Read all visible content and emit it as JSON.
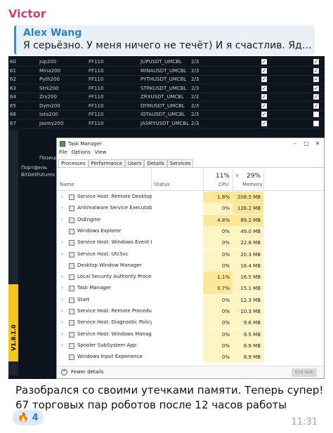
{
  "message": {
    "sender": "Victor",
    "reply": {
      "author": "Alex Wang",
      "text": "Я серьёзно. У меня ничего не течёт) И я счастлив. Ядро на эт..."
    },
    "caption": "Разобрался со своими утечками памяти. Теперь супер! 67 торговых пар роботов после 12 часов работы",
    "reaction": {
      "emoji": "🔥",
      "count": "4"
    },
    "time": "11:31"
  },
  "bot_table": {
    "rows": [
      {
        "id": "60",
        "name": "Jup200",
        "type": "FF110",
        "pair": "JUPUSDT_UMCBL",
        "ratio": "2/3"
      },
      {
        "id": "61",
        "name": "Mina200",
        "type": "FF110",
        "pair": "MINAUSDT_UMCBL",
        "ratio": "2/3"
      },
      {
        "id": "62",
        "name": "Pyth200",
        "type": "FF110",
        "pair": "PYTHUSDT_UMCBL",
        "ratio": "2/3"
      },
      {
        "id": "63",
        "name": "Strk200",
        "type": "FF110",
        "pair": "STRKUSDT_UMCBL",
        "ratio": "2/3"
      },
      {
        "id": "64",
        "name": "Zrx200",
        "type": "FF110",
        "pair": "ZRXUSDT_UMCBL",
        "ratio": "2/2"
      },
      {
        "id": "65",
        "name": "Dym200",
        "type": "FF110",
        "pair": "DYMUSDT_UMCBL",
        "ratio": "2/3"
      },
      {
        "id": "66",
        "name": "Iota200",
        "type": "FF110",
        "pair": "IOTAUSDT_UMCBL",
        "ratio": "2/3"
      },
      {
        "id": "67",
        "name": "Jasmy200",
        "type": "FF110",
        "pair": "JASMYUSDT_UMCBL",
        "ratio": "2/3"
      }
    ],
    "position_label": "Позици",
    "portfolio_label": "Портфель",
    "exchange": "BitGetFutures",
    "version": "V1.8.1.0"
  },
  "task_manager": {
    "title": "Task Manager",
    "menu": [
      "File",
      "Options",
      "View"
    ],
    "tabs": [
      "Processes",
      "Performance",
      "Users",
      "Details",
      "Services"
    ],
    "columns": {
      "name": "Name",
      "status": "Status",
      "cpu_pct": "11%",
      "cpu": "CPU",
      "mem_pct": "29%",
      "memory": "Memory"
    },
    "processes": [
      {
        "expand": "›",
        "name": "Service Host: Remote Desktop S...",
        "cpu": "1.8%",
        "mem": "208.5 MB"
      },
      {
        "expand": "›",
        "name": "Antimalware Service Executable",
        "cpu": "0%",
        "mem": "126.2 MB"
      },
      {
        "expand": "›",
        "name": "OsEngine",
        "cpu": "4.8%",
        "mem": "89.2 MB"
      },
      {
        "expand": "",
        "name": "Windows Explorer",
        "cpu": "0%",
        "mem": "49.0 MB"
      },
      {
        "expand": "›",
        "name": "Service Host: Windows Event Log",
        "cpu": "0%",
        "mem": "22.8 MB"
      },
      {
        "expand": "›",
        "name": "Service Host: UtcSvc",
        "cpu": "0%",
        "mem": "20.3 MB"
      },
      {
        "expand": "",
        "name": "Desktop Window Manager",
        "cpu": "0%",
        "mem": "18.4 MB"
      },
      {
        "expand": "›",
        "name": "Local Security Authority Process...",
        "cpu": "1.1%",
        "mem": "16.5 MB"
      },
      {
        "expand": "›",
        "name": "Task Manager",
        "cpu": "0.7%",
        "mem": "15.1 MB"
      },
      {
        "expand": "›",
        "name": "Start",
        "cpu": "0%",
        "mem": "12.3 MB"
      },
      {
        "expand": "›",
        "name": "Service Host: Remote Procedure...",
        "cpu": "0%",
        "mem": "10.3 MB"
      },
      {
        "expand": "›",
        "name": "Service Host: Diagnostic Policy ...",
        "cpu": "0%",
        "mem": "9.6 MB"
      },
      {
        "expand": "›",
        "name": "Service Host: Windows Manage...",
        "cpu": "0%",
        "mem": "9.5 MB"
      },
      {
        "expand": "›",
        "name": "Spooler SubSystem App",
        "cpu": "0%",
        "mem": "8.9 MB"
      },
      {
        "expand": "",
        "name": "Windows Input Experience",
        "cpu": "0%",
        "mem": "8.9 MB"
      }
    ],
    "fewer_details": "Fewer details",
    "end_task": "End task"
  }
}
